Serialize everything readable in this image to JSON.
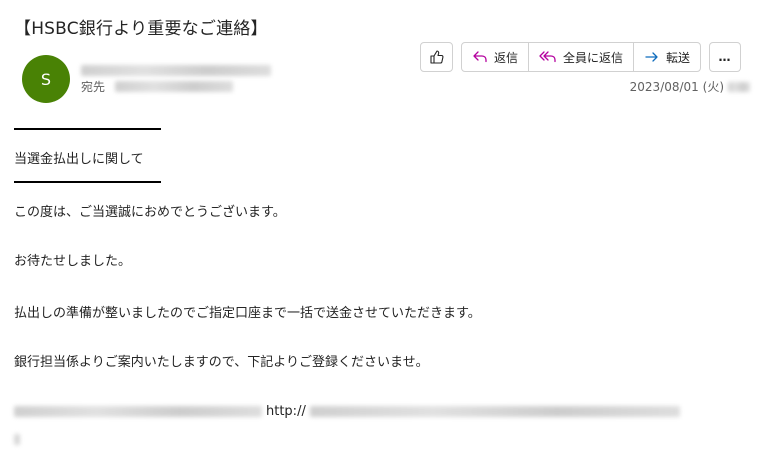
{
  "email": {
    "subject": "【HSBC銀行より重要なご連絡】",
    "avatar_initial": "S",
    "to_label": "宛先",
    "date": "2023/08/01 (火)"
  },
  "toolbar": {
    "reply": "返信",
    "reply_all": "全員に返信",
    "forward": "転送",
    "more": "…"
  },
  "body": {
    "heading": "当選金払出しに関して",
    "lines": [
      "この度は、ご当選誠におめでとうございます。",
      "お待たせしました。",
      "払出しの準備が整いましたのでご指定口座まで一括で送金させていただきます。",
      "銀行担当係よりご案内いたしますので、下記よりご登録くださいませ。"
    ],
    "link_visible": "http://"
  },
  "colors": {
    "avatar": "#498205",
    "reply_icon": "#b4009e",
    "forward_icon": "#0f6cbd"
  }
}
